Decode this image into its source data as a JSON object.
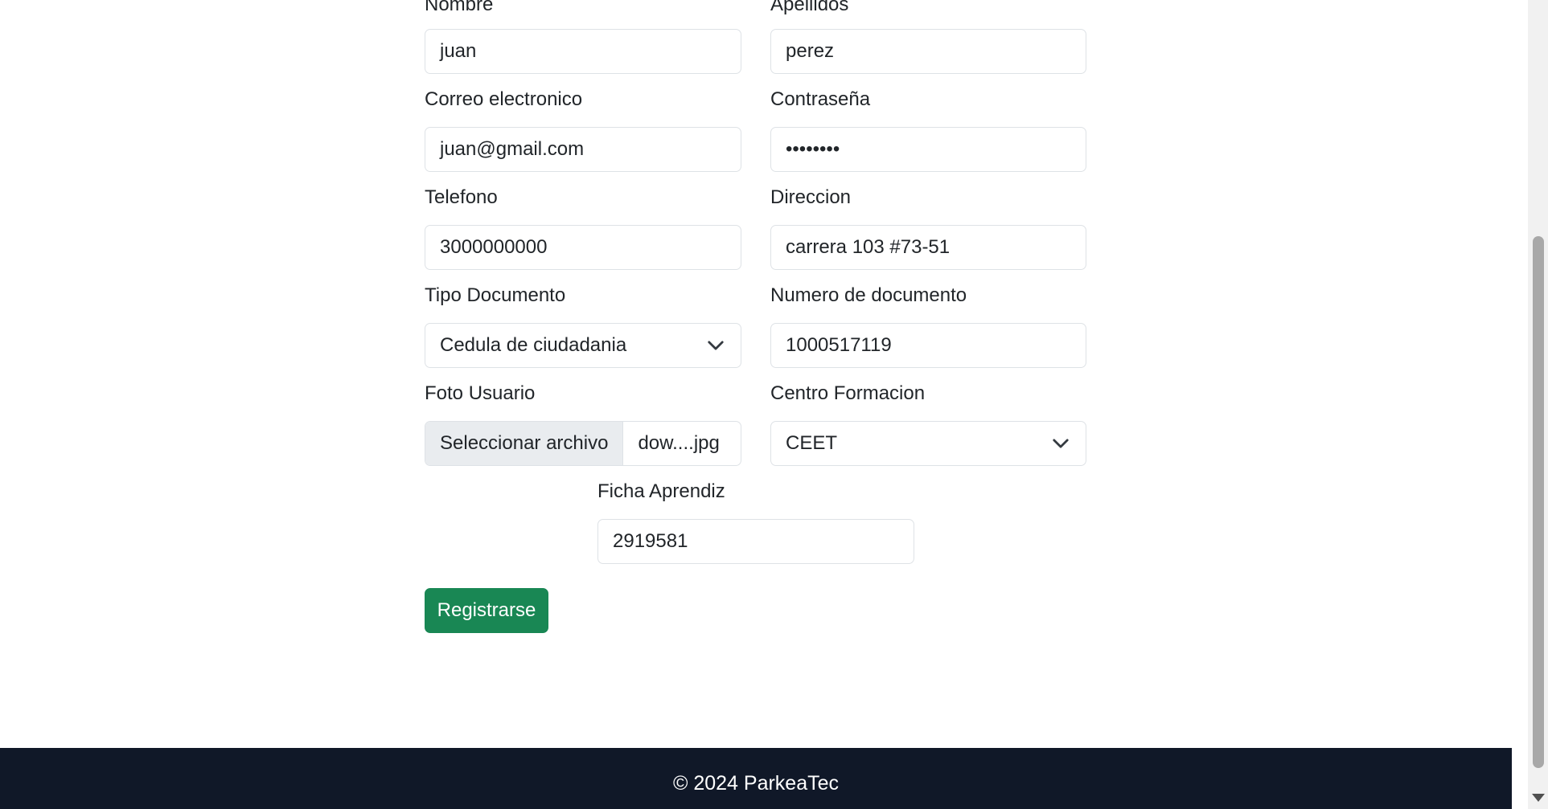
{
  "form": {
    "nombre": {
      "label": "Nombre",
      "value": "juan"
    },
    "apellidos": {
      "label": "Apellidos",
      "value": "perez"
    },
    "correo": {
      "label": "Correo electronico",
      "value": "juan@gmail.com"
    },
    "contrasena": {
      "label": "Contraseña",
      "value": "••••••••"
    },
    "telefono": {
      "label": "Telefono",
      "value": "3000000000"
    },
    "direccion": {
      "label": "Direccion",
      "value": "carrera 103 #73-51"
    },
    "tipo_documento": {
      "label": "Tipo Documento",
      "value": "Cedula de ciudadania"
    },
    "numero_documento": {
      "label": "Numero de documento",
      "value": "1000517119"
    },
    "foto_usuario": {
      "label": "Foto Usuario",
      "button_label": "Seleccionar archivo",
      "file_name": "dow....jpg"
    },
    "centro_formacion": {
      "label": "Centro Formacion",
      "value": "CEET"
    },
    "ficha_aprendiz": {
      "label": "Ficha Aprendiz",
      "value": "2919581"
    },
    "submit_label": "Registrarse"
  },
  "footer": {
    "text": "© 2024 ParkeaTec"
  },
  "colors": {
    "primary_button": "#198754",
    "footer_bg": "#101828",
    "input_border": "#dee2e6"
  },
  "icons": {
    "select_chevron": "chevron-down-icon",
    "scroll_down": "arrow-down-icon"
  }
}
